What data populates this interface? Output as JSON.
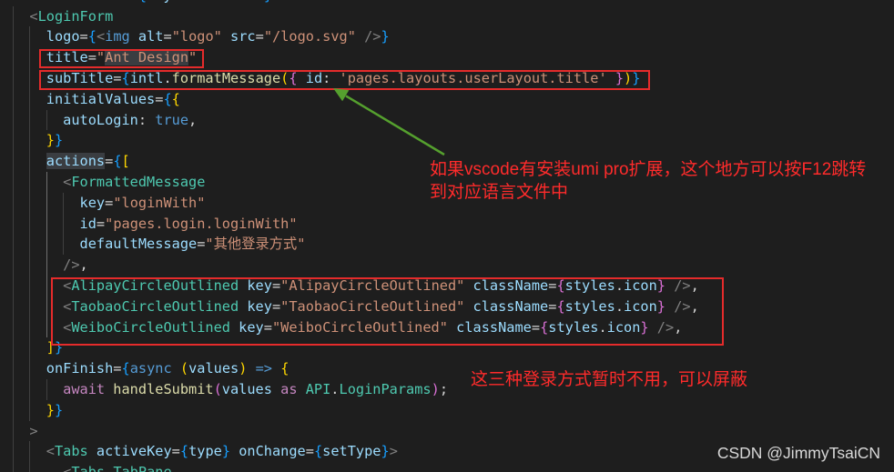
{
  "editor": {
    "background": "#1e1e1e",
    "lines": [
      [
        [
          "<",
          "#808080"
        ],
        [
          "div",
          "#569CD6"
        ],
        [
          " className",
          "#9CDCFE"
        ],
        [
          "=",
          "#D4D4D4"
        ],
        [
          "{",
          "#179FFF"
        ],
        [
          "styles",
          "#9CDCFE"
        ],
        [
          ".",
          "#D4D4D4"
        ],
        [
          "content",
          "#9CDCFE"
        ],
        [
          "}",
          "#179FFF"
        ],
        [
          ">",
          "#808080"
        ]
      ],
      [
        [
          "  <",
          "#808080"
        ],
        [
          "LoginForm",
          "#4EC9B0"
        ]
      ],
      [
        [
          "    logo",
          "#9CDCFE"
        ],
        [
          "=",
          "#D4D4D4"
        ],
        [
          "{",
          "#179FFF"
        ],
        [
          "<",
          "#808080"
        ],
        [
          "img",
          "#569CD6"
        ],
        [
          " alt",
          "#9CDCFE"
        ],
        [
          "=",
          "#D4D4D4"
        ],
        [
          "\"logo\"",
          "#CE9178"
        ],
        [
          " src",
          "#9CDCFE"
        ],
        [
          "=",
          "#D4D4D4"
        ],
        [
          "\"/logo.svg\"",
          "#CE9178"
        ],
        [
          " />",
          "#808080"
        ],
        [
          "}",
          "#179FFF"
        ]
      ],
      [
        [
          "    title",
          "#9CDCFE"
        ],
        [
          "=",
          "#D4D4D4"
        ],
        [
          "\"",
          "#CE9178"
        ],
        [
          "Ant Design",
          "#CE9178",
          "#3a3d41"
        ],
        [
          "\"",
          "#CE9178"
        ]
      ],
      [
        [
          "    subTitle",
          "#9CDCFE"
        ],
        [
          "=",
          "#D4D4D4"
        ],
        [
          "{",
          "#179FFF"
        ],
        [
          "intl",
          "#9CDCFE"
        ],
        [
          ".",
          "#D4D4D4"
        ],
        [
          "formatMessage",
          "#DCDCAA"
        ],
        [
          "(",
          "#FFD700"
        ],
        [
          "{",
          "#DA70D6"
        ],
        [
          " id",
          "#9CDCFE"
        ],
        [
          ": ",
          "#D4D4D4"
        ],
        [
          "'pages.layouts.userLayout.title'",
          "#CE9178"
        ],
        [
          " }",
          "#DA70D6"
        ],
        [
          ")",
          "#FFD700"
        ],
        [
          "}",
          "#179FFF"
        ]
      ],
      [
        [
          "    initialValues",
          "#9CDCFE"
        ],
        [
          "=",
          "#D4D4D4"
        ],
        [
          "{",
          "#179FFF"
        ],
        [
          "{",
          "#FFD700"
        ]
      ],
      [
        [
          "      autoLogin",
          "#9CDCFE"
        ],
        [
          ": ",
          "#D4D4D4"
        ],
        [
          "true",
          "#569CD6"
        ],
        [
          ",",
          "#D4D4D4"
        ]
      ],
      [
        [
          "    }",
          "#FFD700"
        ],
        [
          "}",
          "#179FFF"
        ]
      ],
      [
        [
          "    ",
          "#D4D4D4"
        ],
        [
          "actions",
          "#9CDCFE",
          "#3a3d41"
        ],
        [
          "=",
          "#D4D4D4"
        ],
        [
          "{",
          "#179FFF"
        ],
        [
          "[",
          "#FFD700"
        ]
      ],
      [
        [
          "      <",
          "#808080"
        ],
        [
          "FormattedMessage",
          "#4EC9B0"
        ]
      ],
      [
        [
          "        key",
          "#9CDCFE"
        ],
        [
          "=",
          "#D4D4D4"
        ],
        [
          "\"loginWith\"",
          "#CE9178"
        ]
      ],
      [
        [
          "        id",
          "#9CDCFE"
        ],
        [
          "=",
          "#D4D4D4"
        ],
        [
          "\"pages.login.loginWith\"",
          "#CE9178"
        ]
      ],
      [
        [
          "        defaultMessage",
          "#9CDCFE"
        ],
        [
          "=",
          "#D4D4D4"
        ],
        [
          "\"其他登录方式\"",
          "#CE9178"
        ]
      ],
      [
        [
          "      />",
          "#808080"
        ],
        [
          ",",
          "#D4D4D4"
        ]
      ],
      [
        [
          "      <",
          "#808080"
        ],
        [
          "AlipayCircleOutlined",
          "#4EC9B0"
        ],
        [
          " key",
          "#9CDCFE"
        ],
        [
          "=",
          "#D4D4D4"
        ],
        [
          "\"AlipayCircleOutlined\"",
          "#CE9178"
        ],
        [
          " className",
          "#9CDCFE"
        ],
        [
          "=",
          "#D4D4D4"
        ],
        [
          "{",
          "#DA70D6"
        ],
        [
          "styles",
          "#9CDCFE"
        ],
        [
          ".",
          "#D4D4D4"
        ],
        [
          "icon",
          "#9CDCFE"
        ],
        [
          "}",
          "#DA70D6"
        ],
        [
          " />",
          "#808080"
        ],
        [
          ",",
          "#D4D4D4"
        ]
      ],
      [
        [
          "      <",
          "#808080"
        ],
        [
          "TaobaoCircleOutlined",
          "#4EC9B0"
        ],
        [
          " key",
          "#9CDCFE"
        ],
        [
          "=",
          "#D4D4D4"
        ],
        [
          "\"TaobaoCircleOutlined\"",
          "#CE9178"
        ],
        [
          " className",
          "#9CDCFE"
        ],
        [
          "=",
          "#D4D4D4"
        ],
        [
          "{",
          "#DA70D6"
        ],
        [
          "styles",
          "#9CDCFE"
        ],
        [
          ".",
          "#D4D4D4"
        ],
        [
          "icon",
          "#9CDCFE"
        ],
        [
          "}",
          "#DA70D6"
        ],
        [
          " />",
          "#808080"
        ],
        [
          ",",
          "#D4D4D4"
        ]
      ],
      [
        [
          "      <",
          "#808080"
        ],
        [
          "WeiboCircleOutlined",
          "#4EC9B0"
        ],
        [
          " key",
          "#9CDCFE"
        ],
        [
          "=",
          "#D4D4D4"
        ],
        [
          "\"WeiboCircleOutlined\"",
          "#CE9178"
        ],
        [
          " className",
          "#9CDCFE"
        ],
        [
          "=",
          "#D4D4D4"
        ],
        [
          "{",
          "#DA70D6"
        ],
        [
          "styles",
          "#9CDCFE"
        ],
        [
          ".",
          "#D4D4D4"
        ],
        [
          "icon",
          "#9CDCFE"
        ],
        [
          "}",
          "#DA70D6"
        ],
        [
          " />",
          "#808080"
        ],
        [
          ",",
          "#D4D4D4"
        ]
      ],
      [
        [
          "    ]",
          "#FFD700"
        ],
        [
          "}",
          "#179FFF"
        ]
      ],
      [
        [
          "    onFinish",
          "#9CDCFE"
        ],
        [
          "=",
          "#D4D4D4"
        ],
        [
          "{",
          "#179FFF"
        ],
        [
          "async",
          "#569CD6"
        ],
        [
          " (",
          "#FFD700"
        ],
        [
          "values",
          "#9CDCFE"
        ],
        [
          ")",
          "#FFD700"
        ],
        [
          " =>",
          "#569CD6"
        ],
        [
          " {",
          "#FFD700"
        ]
      ],
      [
        [
          "      await",
          "#C586C0"
        ],
        [
          " handleSubmit",
          "#DCDCAA"
        ],
        [
          "(",
          "#DA70D6"
        ],
        [
          "values",
          "#9CDCFE"
        ],
        [
          " as",
          "#C586C0"
        ],
        [
          " API",
          "#4EC9B0"
        ],
        [
          ".",
          "#D4D4D4"
        ],
        [
          "LoginParams",
          "#4EC9B0"
        ],
        [
          ")",
          "#DA70D6"
        ],
        [
          ";",
          "#D4D4D4"
        ]
      ],
      [
        [
          "    }",
          "#FFD700"
        ],
        [
          "}",
          "#179FFF"
        ]
      ],
      [
        [
          "  >",
          "#808080"
        ]
      ],
      [
        [
          "    <",
          "#808080"
        ],
        [
          "Tabs",
          "#4EC9B0"
        ],
        [
          " activeKey",
          "#9CDCFE"
        ],
        [
          "=",
          "#D4D4D4"
        ],
        [
          "{",
          "#179FFF"
        ],
        [
          "type",
          "#9CDCFE"
        ],
        [
          "}",
          "#179FFF"
        ],
        [
          " onChange",
          "#9CDCFE"
        ],
        [
          "=",
          "#D4D4D4"
        ],
        [
          "{",
          "#179FFF"
        ],
        [
          "setType",
          "#9CDCFE"
        ],
        [
          "}",
          "#179FFF"
        ],
        [
          ">",
          "#808080"
        ]
      ],
      [
        [
          "      <",
          "#808080"
        ],
        [
          "Tabs",
          "#4EC9B0"
        ],
        [
          ".",
          "#D4D4D4"
        ],
        [
          "TabPane",
          "#4EC9B0"
        ]
      ]
    ]
  },
  "annotations": {
    "box_color": "#e52b2b",
    "arrow_color": "#55a02e",
    "note_color": "#ff2b2b",
    "jump_note": [
      "如果vscode有安装umi pro扩展，这个地方可以按F12跳转",
      "到对应语言文件中"
    ],
    "disable_note": "这三种登录方式暂时不用，可以屏蔽"
  },
  "watermark": {
    "text": "CSDN @JimmyTsaiCN"
  }
}
